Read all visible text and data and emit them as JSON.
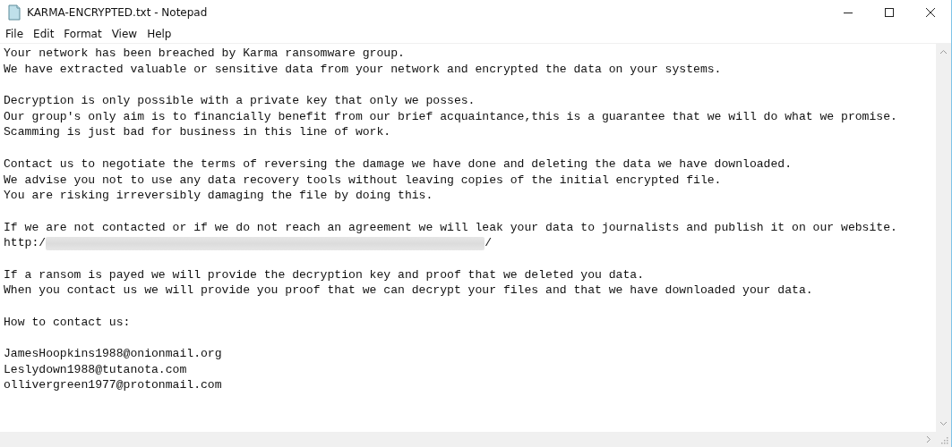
{
  "window": {
    "title": "KARMA-ENCRYPTED.txt - Notepad"
  },
  "menu": [
    "File",
    "Edit",
    "Format",
    "View",
    "Help"
  ],
  "document": {
    "lines": [
      {
        "kind": "text",
        "text": "Your network has been breached by Karma ransomware group."
      },
      {
        "kind": "text",
        "text": "We have extracted valuable or sensitive data from your network and encrypted the data on your systems."
      },
      {
        "kind": "blank"
      },
      {
        "kind": "text",
        "text": "Decryption is only possible with a private key that only we posses."
      },
      {
        "kind": "text",
        "text": "Our group's only aim is to financially benefit from our brief acquaintance,this is a guarantee that we will do what we promise."
      },
      {
        "kind": "text",
        "text": "Scamming is just bad for business in this line of work."
      },
      {
        "kind": "blank"
      },
      {
        "kind": "text",
        "text": "Contact us to negotiate the terms of reversing the damage we have done and deleting the data we have downloaded."
      },
      {
        "kind": "text",
        "text": "We advise you not to use any data recovery tools without leaving copies of the initial encrypted file."
      },
      {
        "kind": "text",
        "text": "You are risking irreversibly damaging the file by doing this."
      },
      {
        "kind": "blank"
      },
      {
        "kind": "text",
        "text": "If we are not contacted or if we do not reach an agreement we will leak your data to journalists and publish it on our website."
      },
      {
        "kind": "redacted",
        "before": "http:/",
        "after": "/"
      },
      {
        "kind": "blank"
      },
      {
        "kind": "text",
        "text": "If a ransom is payed we will provide the decryption key and proof that we deleted you data."
      },
      {
        "kind": "text",
        "text": "When you contact us we will provide you proof that we can decrypt your files and that we have downloaded your data."
      },
      {
        "kind": "blank"
      },
      {
        "kind": "text",
        "text": "How to contact us:"
      },
      {
        "kind": "blank"
      },
      {
        "kind": "text",
        "text": "JamesHoopkins1988@onionmail.org"
      },
      {
        "kind": "text",
        "text": "Leslydown1988@tutanota.com"
      },
      {
        "kind": "text",
        "text": "ollivergreen1977@protonmail.com"
      }
    ]
  }
}
